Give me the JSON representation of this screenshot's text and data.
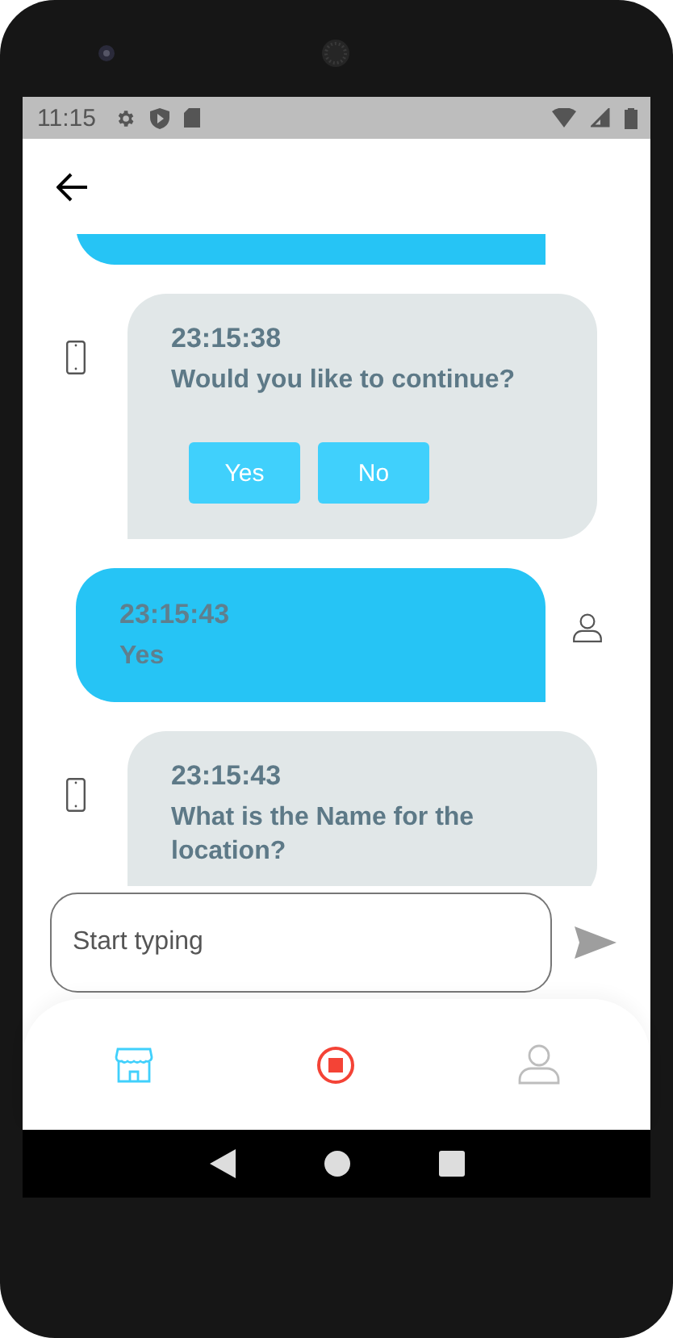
{
  "status_bar": {
    "time": "11:15"
  },
  "messages": [
    {
      "kind": "user"
    },
    {
      "kind": "bot",
      "time": "23:15:38",
      "text": "Would you like to continue?",
      "options": [
        {
          "label": "Yes"
        },
        {
          "label": "No"
        }
      ]
    },
    {
      "kind": "user",
      "time": "23:15:43",
      "text": "Yes"
    },
    {
      "kind": "bot",
      "time": "23:15:43",
      "text": "What is the Name for the location?"
    }
  ],
  "composer": {
    "placeholder": "Start typing"
  },
  "bottom_nav": [
    {
      "kind": "store",
      "selected": true
    },
    {
      "kind": "record",
      "selected": false
    },
    {
      "kind": "profile",
      "selected": false
    }
  ]
}
